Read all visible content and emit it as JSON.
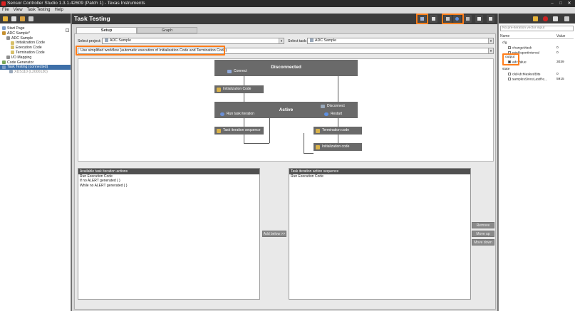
{
  "window": {
    "title": "Sensor Controller Studio 1.3.1.42609 (Patch 1) - Texas Instruments",
    "controls": [
      "–",
      "□",
      "✕"
    ]
  },
  "menu": [
    "File",
    "View",
    "Task Testing",
    "Help"
  ],
  "left_tree": [
    {
      "label": "Start Page",
      "icon": "page-icon",
      "level": 0
    },
    {
      "label": "ADC Sample*",
      "icon": "project-icon",
      "level": 0
    },
    {
      "label": "ADC Sample",
      "icon": "task-icon",
      "level": 1
    },
    {
      "label": "Initialization Code",
      "icon": "file-icon",
      "level": 2
    },
    {
      "label": "Execution Code",
      "icon": "file-icon",
      "level": 2
    },
    {
      "label": "Termination Code",
      "icon": "file-icon",
      "level": 2
    },
    {
      "label": "I/O Mapping",
      "icon": "mapping-icon",
      "level": 1
    },
    {
      "label": "Code Generator",
      "icon": "generator-icon",
      "level": 0
    },
    {
      "label": "Task Testing (connected)",
      "icon": "testing-icon",
      "level": 0
    },
    {
      "label": "XDS110 (L2000130)",
      "icon": "device-icon",
      "level": 1
    }
  ],
  "center": {
    "title": "Task Testing",
    "tabs": [
      "Setup",
      "Graph"
    ],
    "select_project_label": "Select project:",
    "select_project_value": "ADC Sample",
    "select_task_label": "Select task:",
    "select_task_value": "ADC Sample",
    "workflow_value": "Use simplified workflow (automatic execution of Initialization Code and Termination Code)"
  },
  "diagram": {
    "disconnected": "Disconnected",
    "connect": "Connect",
    "init_code": "Initialization Code",
    "active": "Active",
    "run_iteration": "Run task iteration",
    "disconnect": "Disconnect",
    "restart": "Restart",
    "iteration_sequence": "Task iteration sequence",
    "termination_code": "Termination code",
    "init_code_2": "Initialization code"
  },
  "available_actions": {
    "header": "Available task iteration actions",
    "items": [
      "Run Execution Code",
      "If no ALERT generated { }",
      "While no ALERT generated { }"
    ]
  },
  "sequence": {
    "header": "Task iteration action sequence",
    "items": [
      "Run Execution Code"
    ]
  },
  "buttons": {
    "add_below": "Add below >>",
    "remove": "Remove",
    "move_up": "Move up",
    "move_down": "Move down"
  },
  "right": {
    "filter_placeholder": "No pre-iteration vector input",
    "col_name": "Name",
    "col_value": "Value",
    "rows": [
      {
        "name": "cfg",
        "value": "",
        "level": 0,
        "checkbox": false
      },
      {
        "name": "changeMask",
        "value": "0",
        "level": 2,
        "checkbox": true
      },
      {
        "name": "minReportInterval",
        "value": "0",
        "level": 2,
        "checkbox": true
      },
      {
        "name": "output",
        "value": "",
        "level": 0,
        "checkbox": false
      },
      {
        "name": "adcValue",
        "value": "3039",
        "level": 2,
        "checkbox": true,
        "checked": true
      },
      {
        "name": "state",
        "value": "",
        "level": 0,
        "checkbox": false
      },
      {
        "name": "oldAdcMaskedBits",
        "value": "0",
        "level": 2,
        "checkbox": true
      },
      {
        "name": "samplesSinceLastRe...",
        "value": "5915",
        "level": 2,
        "checkbox": true
      }
    ]
  },
  "colors": {
    "highlight": "#ff7d1a",
    "dark": "#3c3c3c",
    "selection": "#3d6fa8"
  }
}
